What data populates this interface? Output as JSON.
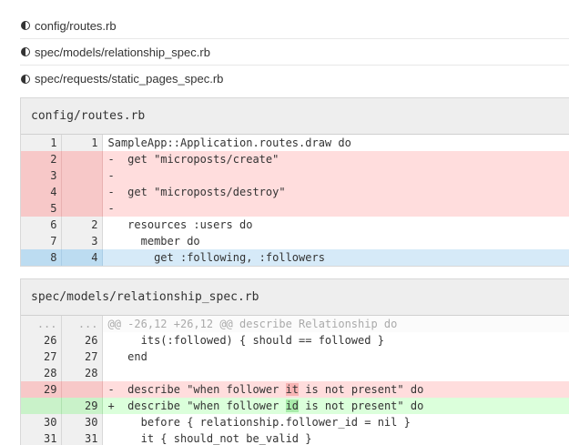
{
  "file_list": [
    {
      "path": "config/routes.rb",
      "icon": "half-circle-icon"
    },
    {
      "path": "spec/models/relationship_spec.rb",
      "icon": "half-circle-icon"
    },
    {
      "path": "spec/requests/static_pages_spec.rb",
      "icon": "half-circle-icon"
    }
  ],
  "diffs": [
    {
      "title": "config/routes.rb",
      "lines": [
        {
          "old": "1",
          "new": "1",
          "type": "ctx",
          "text": "SampleApp::Application.routes.draw do"
        },
        {
          "old": "2",
          "new": "",
          "type": "del",
          "text": "-  get \"microposts/create\""
        },
        {
          "old": "3",
          "new": "",
          "type": "del",
          "text": "-"
        },
        {
          "old": "4",
          "new": "",
          "type": "del",
          "text": "-  get \"microposts/destroy\""
        },
        {
          "old": "5",
          "new": "",
          "type": "del",
          "text": "-"
        },
        {
          "old": "6",
          "new": "2",
          "type": "ctx",
          "text": "   resources :users do"
        },
        {
          "old": "7",
          "new": "3",
          "type": "ctx",
          "text": "     member do"
        },
        {
          "old": "8",
          "new": "4",
          "type": "sel",
          "text": "       get :following, :followers"
        }
      ]
    },
    {
      "title": "spec/models/relationship_spec.rb",
      "lines": [
        {
          "old": "...",
          "new": "...",
          "type": "hunk",
          "text": "@@ -26,12 +26,12 @@ describe Relationship do"
        },
        {
          "old": "26",
          "new": "26",
          "type": "ctx",
          "text": "     its(:followed) { should == followed }"
        },
        {
          "old": "27",
          "new": "27",
          "type": "ctx",
          "text": "   end"
        },
        {
          "old": "28",
          "new": "28",
          "type": "ctx",
          "text": ""
        },
        {
          "old": "29",
          "new": "",
          "type": "del",
          "before": "-  describe \"when follower ",
          "mark": "it",
          "after": " is not present\" do"
        },
        {
          "old": "",
          "new": "29",
          "type": "add",
          "before": "+  describe \"when follower ",
          "mark": "id",
          "after": " is not present\" do"
        },
        {
          "old": "30",
          "new": "30",
          "type": "ctx",
          "text": "     before { relationship.follower_id = nil }"
        },
        {
          "old": "31",
          "new": "31",
          "type": "ctx",
          "text": "     it { should_not be_valid }"
        }
      ]
    }
  ]
}
